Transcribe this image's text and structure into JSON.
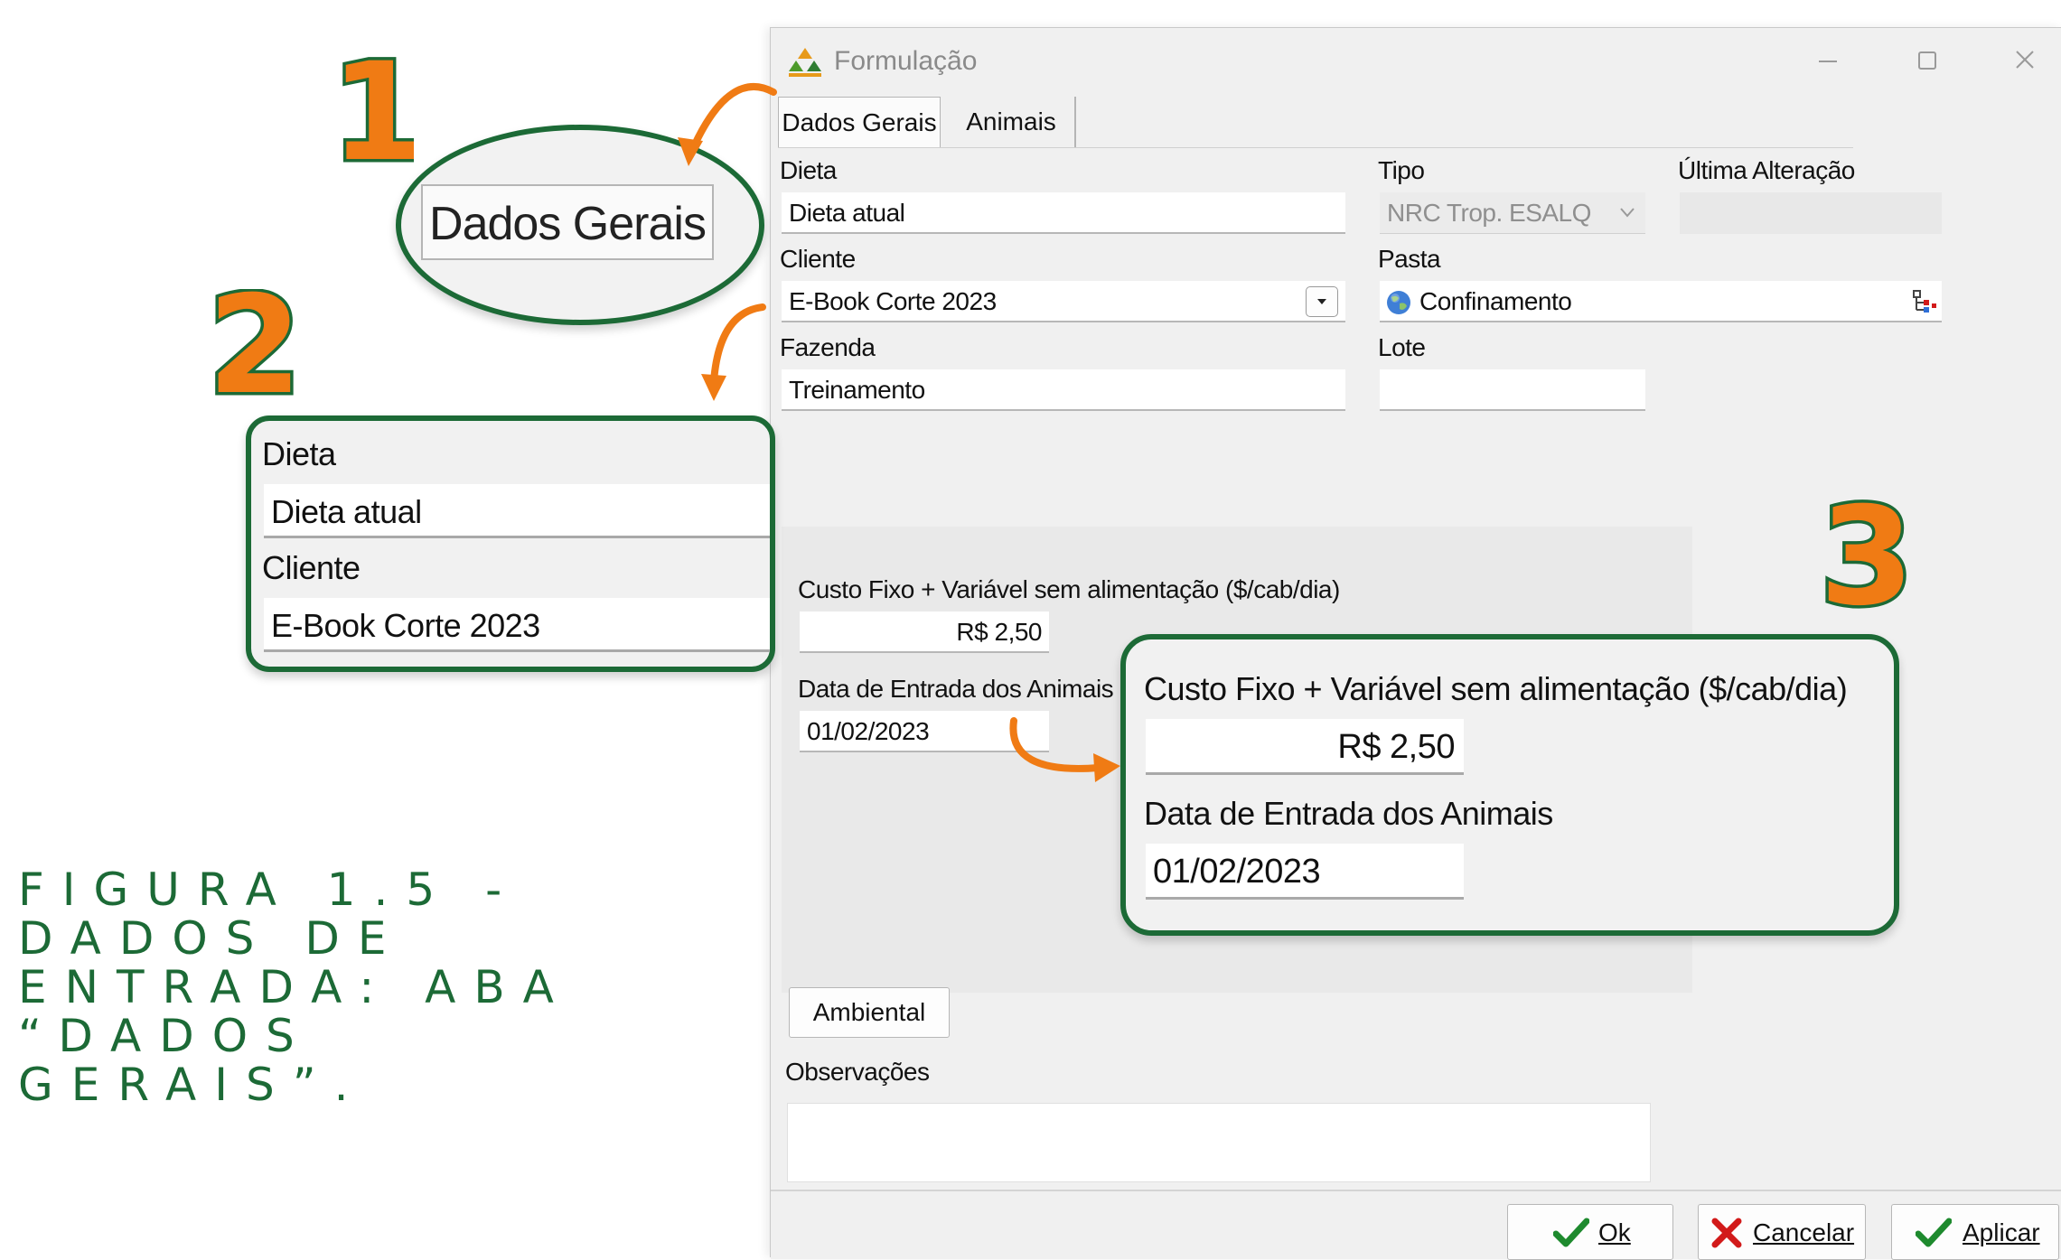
{
  "window": {
    "title": "Formulação",
    "tabs": [
      {
        "label": "Dados Gerais",
        "active": true
      },
      {
        "label": "Animais",
        "active": false
      }
    ]
  },
  "form": {
    "dieta_label": "Dieta",
    "dieta_value": "Dieta atual",
    "tipo_label": "Tipo",
    "tipo_value": "NRC Trop. ESALQ",
    "ultima_alteracao_label": "Última Alteração",
    "ultima_alteracao_value": "",
    "cliente_label": "Cliente",
    "cliente_value": "E-Book Corte 2023",
    "pasta_label": "Pasta",
    "pasta_value": "Confinamento",
    "fazenda_label": "Fazenda",
    "fazenda_value": "Treinamento",
    "lote_label": "Lote",
    "lote_value": "",
    "custo_label": "Custo Fixo + Variável sem alimentação ($/cab/dia)",
    "custo_value": "R$ 2,50",
    "data_entrada_label": "Data de Entrada dos Animais",
    "data_entrada_value": "01/02/2023",
    "ambiental_button": "Ambiental",
    "observacoes_label": "Observações",
    "observacoes_value": ""
  },
  "footer": {
    "ok_button": "Ok",
    "cancel_button": "Cancelar",
    "apply_button": "Aplicar"
  },
  "annotations": {
    "step_numbers": [
      "1",
      "2",
      "3"
    ],
    "caption": "FIGURA 1.5 - DADOS DE ENTRADA: ABA “DADOS GERAIS”.",
    "callout1_tab": "Dados Gerais",
    "callout2": {
      "dieta_label": "Dieta",
      "dieta_value": "Dieta atual",
      "cliente_label": "Cliente",
      "cliente_value": "E-Book Corte 2023"
    },
    "callout3": {
      "custo_label": "Custo Fixo + Variável sem alimentação ($/cab/dia)",
      "custo_value": "R$ 2,50",
      "data_label": "Data de Entrada dos Animais",
      "data_value": "01/02/2023"
    }
  },
  "colors": {
    "annotation_green": "#1c6a36",
    "annotation_orange": "#f07b14",
    "ok_check": "#1e8a2e",
    "cancel_x": "#d21a1a"
  },
  "icons": [
    "app-logo-icon",
    "minimize-icon",
    "maximize-icon",
    "close-icon",
    "chevron-down-icon",
    "globe-icon",
    "folder-tree-icon",
    "check-icon",
    "x-icon",
    "arrow-icon"
  ]
}
